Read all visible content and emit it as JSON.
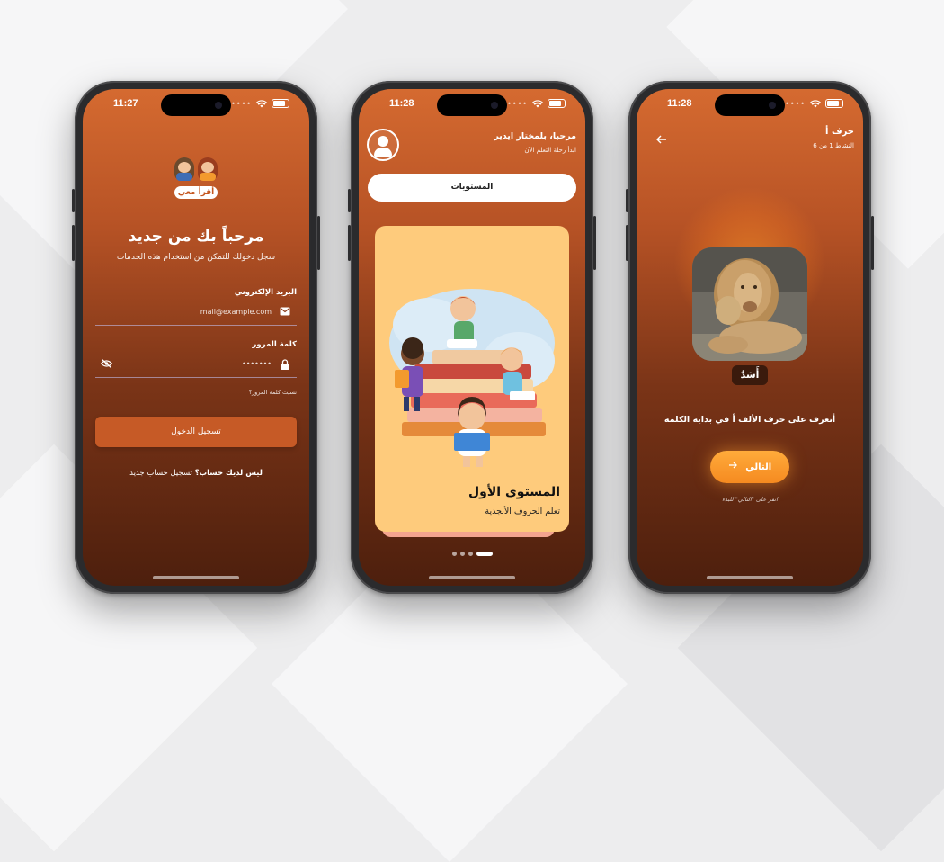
{
  "colors": {
    "accent": "#c65a26",
    "screen_top": "#d56a30",
    "screen_bottom": "#4d1f0d",
    "card": "#fecb7c",
    "next_button": "#f58a20"
  },
  "login": {
    "time": "11:27",
    "logo_text": "أقرأ معي",
    "title": "مرحباً بك من جديد",
    "subtitle": "سجل دخولك للتمكن من استخدام هذه الخدمات",
    "email_label": "البريد الإلكتروني",
    "email_placeholder": "mail@example.com",
    "email_icon": "mail-icon",
    "password_label": "كلمة المرور",
    "password_value": "•••••••",
    "password_icon": "lock-icon",
    "visibility_icon": "eye-off-icon",
    "forgot": "نسيت كلمة المرور؟",
    "login_button": "تسجيل الدخول",
    "no_account": "ليس لديك حساب؟",
    "register": "تسجيل حساب جديد"
  },
  "levels": {
    "time": "11:28",
    "greeting": "مرحبا، بلمختار ايدير",
    "greeting_sub": "ابدأ رحلة التعلم الآن",
    "avatar_icon": "user-avatar-icon",
    "levels_button": "المستويات",
    "card_title": "المستوى الأول",
    "card_subtitle": "تعلم الحروف الأبجدية",
    "pages": 4,
    "active_page": 4
  },
  "lesson": {
    "time": "11:28",
    "title": "حرف أ",
    "activity": "النشاط 1 من 6",
    "back_icon": "arrow-back-icon",
    "word": "أَسَدٌ",
    "instruction": "أتعرف على حرف الألف أ في بداية الكلمة",
    "next_button": "التالي",
    "next_icon": "arrow-right-icon",
    "hint": "انقر على \"التالي\" للبدء"
  }
}
